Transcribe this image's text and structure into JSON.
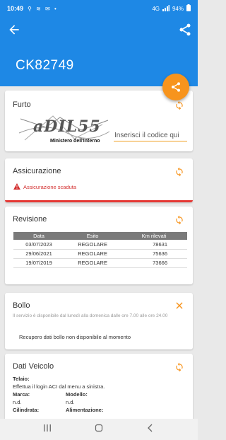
{
  "status": {
    "time": "10:49",
    "left_icons": "⚲ ≋ ✉ •",
    "network": "4G",
    "battery": "94%"
  },
  "header": {
    "plate": "CK82749"
  },
  "furto": {
    "title": "Furto",
    "captcha_text": "aDIL55",
    "captcha_caption": "Ministero dell'Interno",
    "input_placeholder": "Inserisci il codice qui"
  },
  "assicurazione": {
    "title": "Assicurazione",
    "status": "Assicurazione scaduta",
    "status_color": "#d32f2f"
  },
  "revisione": {
    "title": "Revisione",
    "columns": [
      "Data",
      "Esito",
      "Km rilevati"
    ],
    "rows": [
      [
        "03/07/2023",
        "REGOLARE",
        "78631"
      ],
      [
        "29/06/2021",
        "REGOLARE",
        "75636"
      ],
      [
        "19/07/2019",
        "REGOLARE",
        "73666"
      ]
    ]
  },
  "bollo": {
    "title": "Bollo",
    "description": "Il servizio è disponibile dal lunedì alla domenica dalle ore 7.00 alle ore 24.00",
    "message": "Recupero dati bollo non disponibile al momento"
  },
  "dati_veicolo": {
    "title": "Dati Veicolo",
    "telaio_label": "Telaio:",
    "telaio_value": "Effettua il login ACI dal menu a sinistra.",
    "marca_label": "Marca:",
    "marca_value": "n.d.",
    "modello_label": "Modello:",
    "modello_value": "n.d.",
    "cilindrata_label": "Cilindrata:",
    "alimentazione_label": "Alimentazione:"
  },
  "colors": {
    "primary": "#1e88e5",
    "accent": "#f7941d",
    "error": "#e53935"
  },
  "icons": [
    "back-arrow-icon",
    "share-icon",
    "refresh-icon",
    "warning-icon",
    "close-icon",
    "recent-apps-icon",
    "home-icon",
    "back-nav-icon"
  ]
}
